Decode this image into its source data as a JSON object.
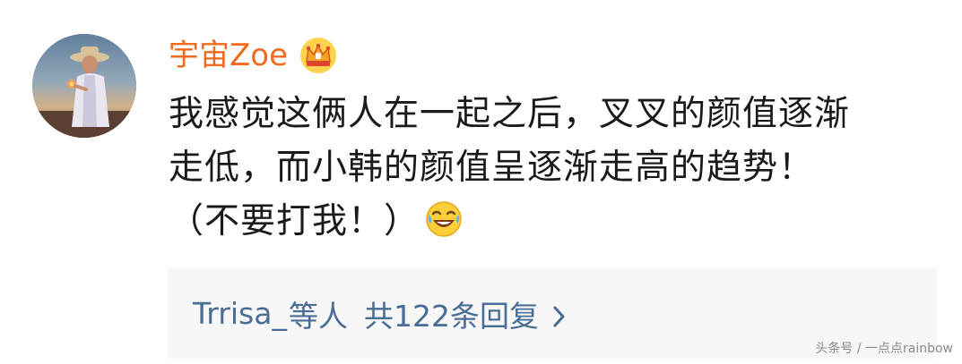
{
  "comment": {
    "username": "宇宙Zoe",
    "badge_icon": "crown-icon",
    "lines": [
      "我感觉这俩人在一起之后，叉叉的颜值逐渐",
      "走低，而小韩的颜值呈逐渐走高的趋势！",
      "（不要打我！）"
    ],
    "trailing_emoji": "laugh-cry-emoji-icon"
  },
  "replies": {
    "users": "Trrisa_",
    "users_suffix": "等人",
    "count_text": "共122条回复",
    "chevron_icon": "chevron-right-icon"
  },
  "watermark": {
    "text": "头条号 / 一点点rainbow"
  },
  "colors": {
    "username": "#f26a1b",
    "link": "#4a6d96",
    "reply_bg": "#f7f7f7",
    "text": "#1a1a1a"
  }
}
